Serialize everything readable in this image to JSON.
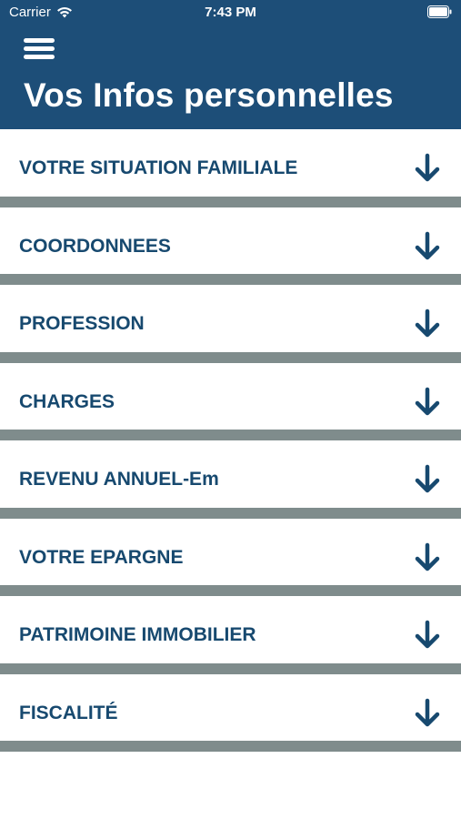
{
  "status_bar": {
    "carrier": "Carrier",
    "time": "7:43 PM"
  },
  "header": {
    "menu_icon": "hamburger-menu-icon",
    "title": "Vos Infos personnelles",
    "background_color": "#1d4e78"
  },
  "sections": [
    {
      "label": "VOTRE SITUATION FAMILIALE",
      "icon": "arrow-down-icon"
    },
    {
      "label": "COORDONNEES",
      "icon": "arrow-down-icon"
    },
    {
      "label": "PROFESSION",
      "icon": "arrow-down-icon"
    },
    {
      "label": "CHARGES",
      "icon": "arrow-down-icon"
    },
    {
      "label": "REVENU ANNUEL-Em",
      "icon": "arrow-down-icon"
    },
    {
      "label": "VOTRE EPARGNE",
      "icon": "arrow-down-icon"
    },
    {
      "label": "PATRIMOINE IMMOBILIER",
      "icon": "arrow-down-icon"
    },
    {
      "label": "FISCALITÉ",
      "icon": "arrow-down-icon"
    }
  ],
  "colors": {
    "text": "#17496f",
    "separator": "#7f8c8c"
  }
}
